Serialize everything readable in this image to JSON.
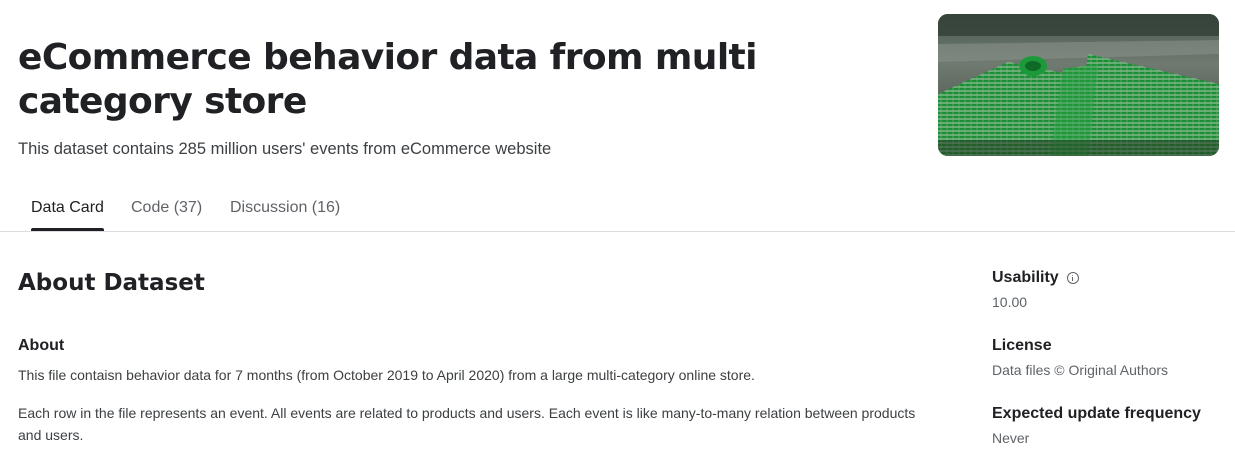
{
  "header": {
    "title": "eCommerce behavior data from multi category store",
    "subtitle": "This dataset contains 285 million users' events from eCommerce website"
  },
  "tabs": [
    {
      "label": "Data Card",
      "active": true
    },
    {
      "label": "Code (37)",
      "active": false
    },
    {
      "label": "Discussion (16)",
      "active": false
    }
  ],
  "about": {
    "heading": "About Dataset",
    "subheading": "About",
    "paragraphs": [
      "This file contaisn behavior data for 7 months (from October 2019 to April 2020) from a large multi-category online store.",
      "Each row in the file represents an event. All events are related to products and users. Each event is like many-to-many relation between products and users."
    ]
  },
  "sidebar": {
    "usability": {
      "label": "Usability",
      "value": "10.00",
      "icon": "info-icon"
    },
    "license": {
      "label": "License",
      "value": "Data files © Original Authors"
    },
    "update": {
      "label": "Expected update frequency",
      "value": "Never"
    }
  },
  "colors": {
    "text_primary": "#202124",
    "text_secondary": "#5f6368",
    "divider": "#dadce0",
    "cart_green": "#1f9e3a"
  }
}
